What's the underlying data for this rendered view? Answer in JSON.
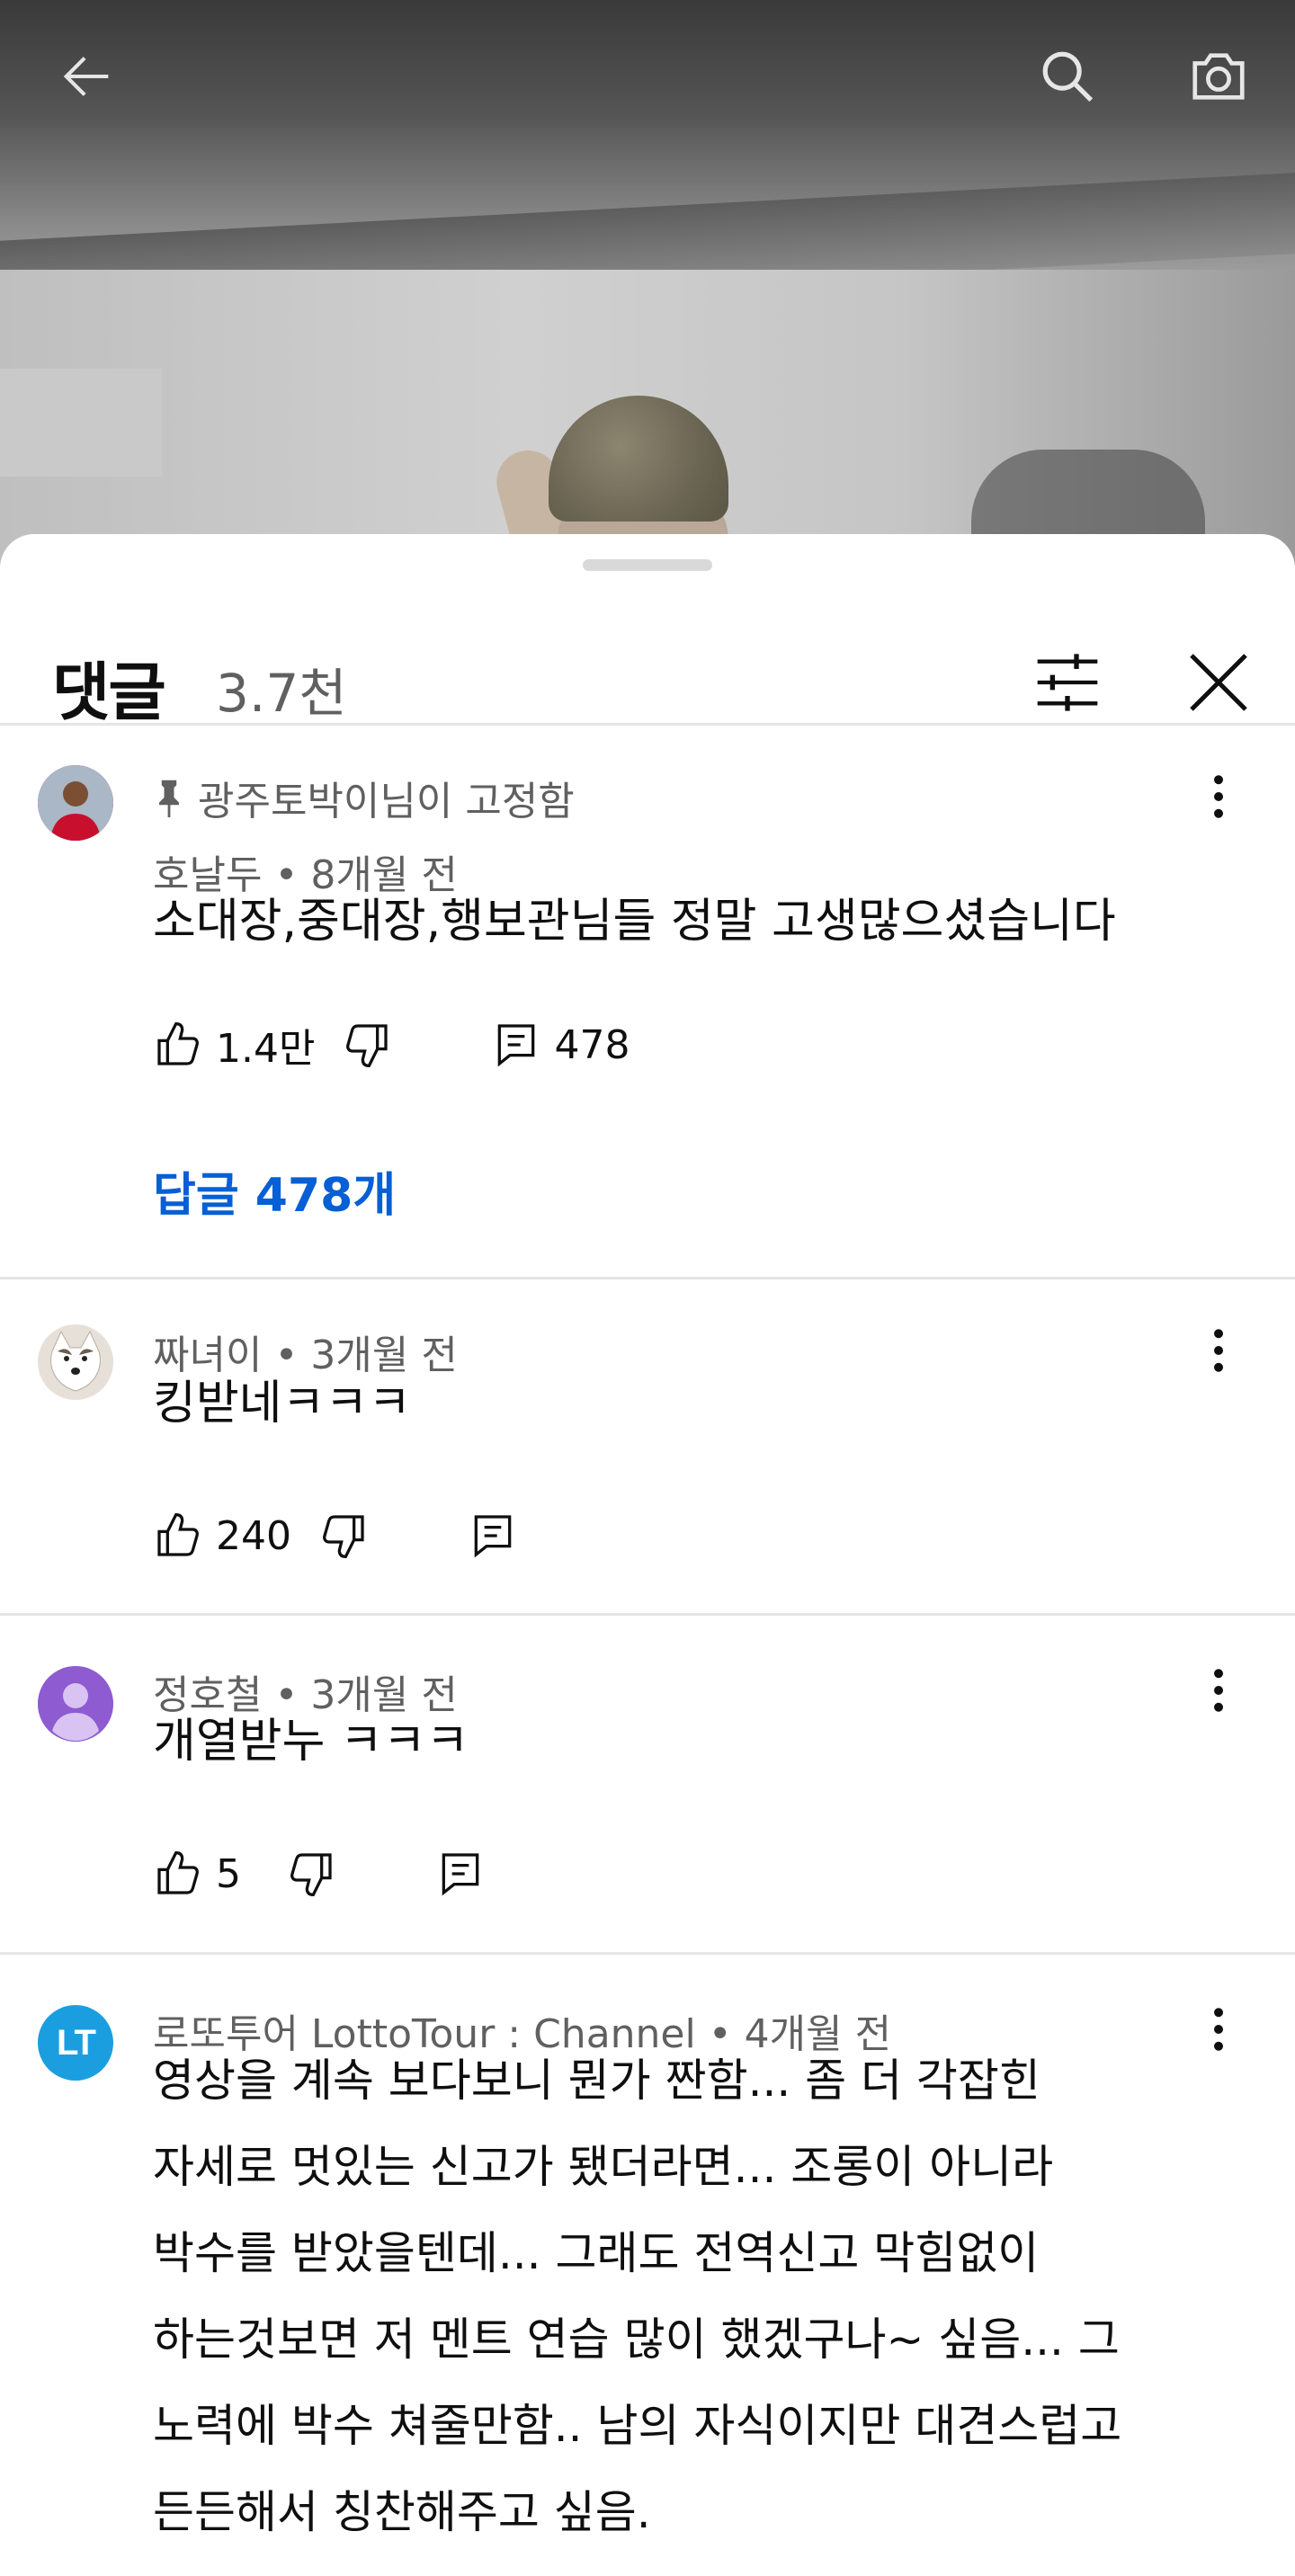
{
  "video": {
    "back_icon": "arrow-left-icon",
    "search_icon": "search-icon",
    "camera_icon": "camera-icon"
  },
  "sheet": {
    "title": "댓글",
    "count": "3.7천",
    "sort_icon": "sliders-icon",
    "close_icon": "close-icon"
  },
  "comments": [
    {
      "pinned_label": "광주토박이님이 고정함",
      "author": "호날두",
      "time": "8개월 전",
      "text": "소대장,중대장,행보관님들 정말 고생많으셨습니다",
      "likes": "1.4만",
      "reply_count": "478",
      "replies_link": "답글 478개",
      "avatar_color": "#c8102e"
    },
    {
      "author": "짜녀이",
      "time": "3개월 전",
      "text": "킹받네ㅋㅋㅋ",
      "likes": "240",
      "avatar_color": "#cfc6b8"
    },
    {
      "author": "정호철",
      "time": "3개월 전",
      "text": "개열받누 ㅋㅋㅋ",
      "likes": "5",
      "avatar_color": "#8e5bd1"
    },
    {
      "author": "로또투어 LottoTour : Channel",
      "time": "4개월 전",
      "text_lines": [
        "영상을 계속 보다보니 뭔가 짠함... 좀 더 각잡힌",
        "자세로 멋있는 신고가 됐더라면... 조롱이 아니라",
        "박수를 받았을텐데... 그래도 전역신고 막힘없이",
        "하는것보면 저 멘트 연습 많이 했겠구나~ 싶음... 그",
        "노력에 박수 쳐줄만함.. 남의 자식이지만 대견스럽고",
        "든든해서 칭찬해주고 싶음."
      ],
      "avatar_text": "LT",
      "avatar_color": "#1a9ee0"
    }
  ],
  "separator": " • "
}
